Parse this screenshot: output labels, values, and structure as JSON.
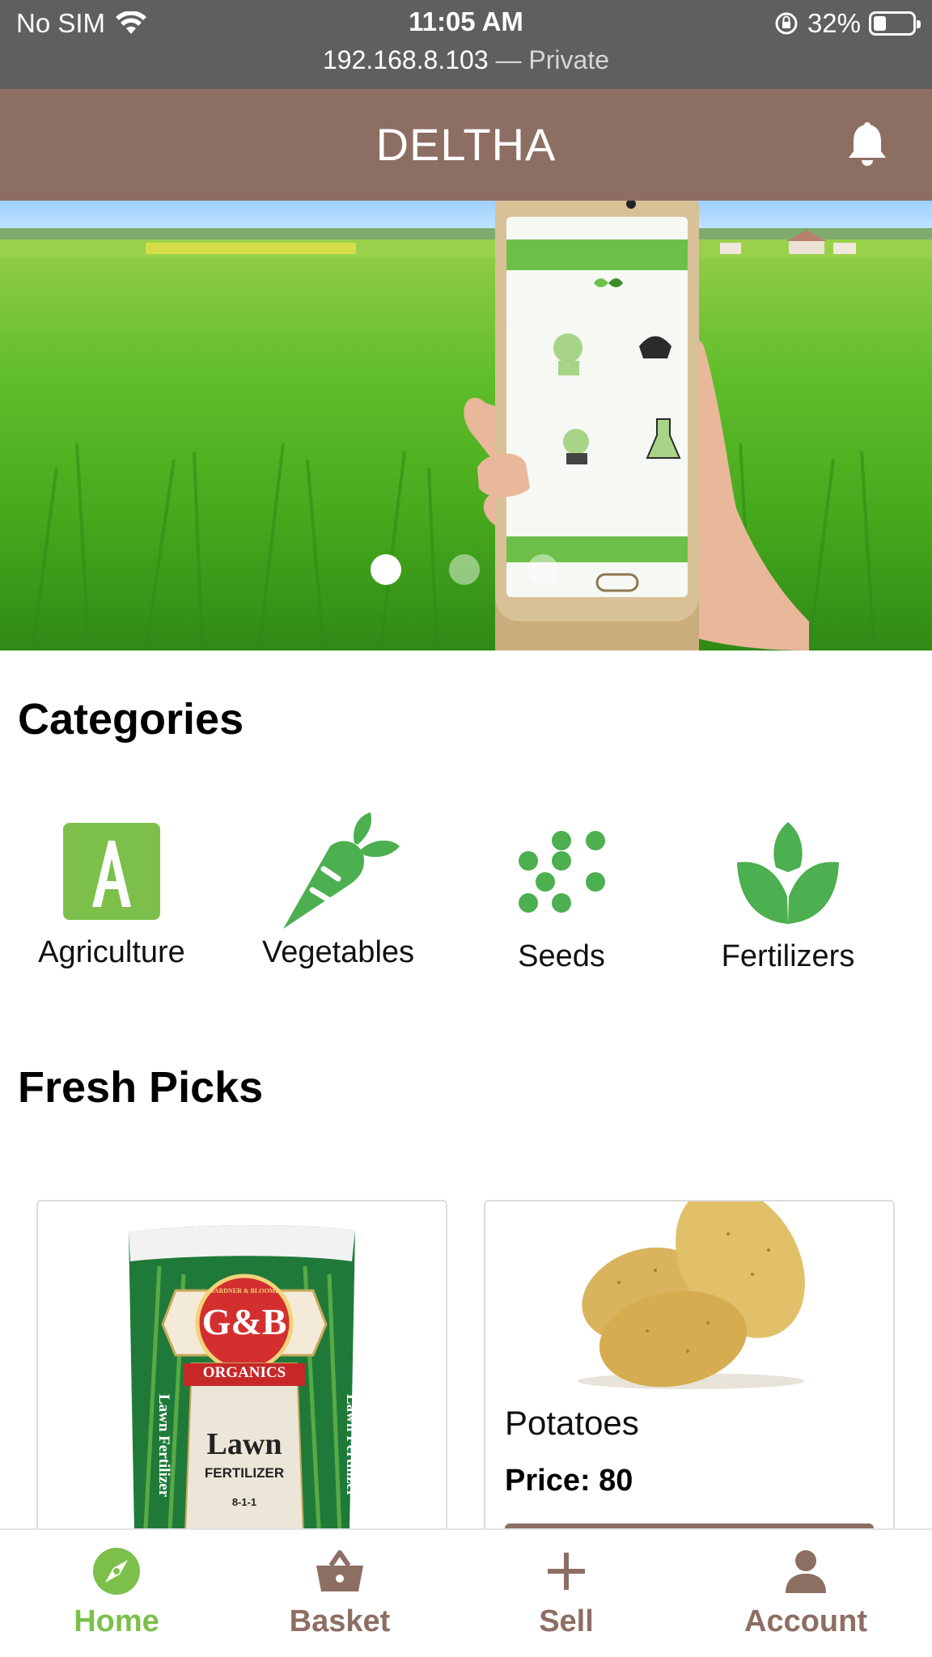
{
  "status_bar": {
    "carrier": "No SIM",
    "time": "11:05 AM",
    "url": "192.168.8.103",
    "url_suffix": "— Private",
    "battery": "32%",
    "battery_level": 0.32
  },
  "header": {
    "title": "DELTHA",
    "icon": "bell-icon"
  },
  "banner": {
    "slide_count": 3,
    "active_slide": 1
  },
  "categories": {
    "title": "Categories",
    "items": [
      {
        "label": "Agriculture",
        "icon": "letter-a-icon"
      },
      {
        "label": "Vegetables",
        "icon": "carrot-icon"
      },
      {
        "label": "Seeds",
        "icon": "seeds-icon"
      },
      {
        "label": "Fertilizers",
        "icon": "leaves-icon"
      }
    ]
  },
  "fresh_picks": {
    "title": "Fresh Picks",
    "products": [
      {
        "image": "fertilizer-bag",
        "bag_text": {
          "brand_top": "GARDNER & BLOOME",
          "brand": "G&B",
          "line": "ORGANICS",
          "side": "Lawn Fertilizer",
          "name": "Lawn",
          "type": "FERTILIZER",
          "npk": "8-1-1"
        }
      },
      {
        "image": "potatoes",
        "name": "Potatoes",
        "price": "Price: 80"
      }
    ]
  },
  "bottom_nav": {
    "items": [
      {
        "label": "Home",
        "icon": "compass-icon",
        "active": true
      },
      {
        "label": "Basket",
        "icon": "basket-icon",
        "active": false
      },
      {
        "label": "Sell",
        "icon": "plus-icon",
        "active": false
      },
      {
        "label": "Account",
        "icon": "person-icon",
        "active": false
      }
    ]
  },
  "colors": {
    "header": "#8d6e63",
    "status_bar": "#5f5f5f",
    "accent_green": "#7cc04b",
    "icon_green": "#4caf50",
    "nav_brown": "#8d6e63"
  }
}
